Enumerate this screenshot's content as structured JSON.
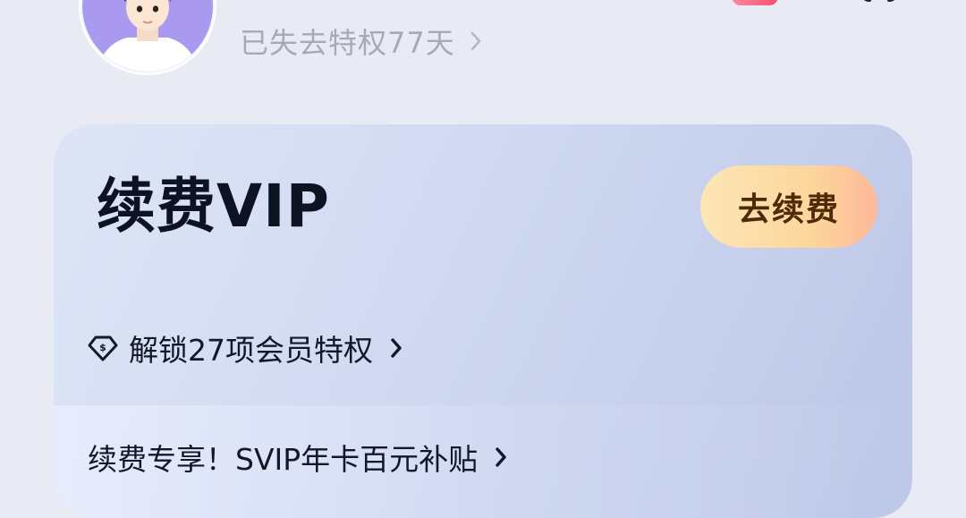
{
  "header": {
    "status_text": "已失去特权77天"
  },
  "vip_card": {
    "title": "续费VIP",
    "renew_button_label": "去续费",
    "privileges_text": "解锁27项会员特权",
    "promo_text": "续费专享！SVIP年卡百元补贴"
  },
  "colors": {
    "page_background": "#e8ebf4",
    "card_gradient_start": "#dde5f6",
    "card_gradient_end": "#bcc6e6",
    "button_gradient_start": "#fde6b6",
    "button_gradient_end": "#ffb89a",
    "button_text": "#4f2a08",
    "title_text": "#0d1322",
    "muted_text": "#a6a9b6"
  },
  "icons": {
    "status_chevron": "chevron-right-icon",
    "privileges_icon": "diamond-dollar-icon",
    "privileges_chevron": "chevron-right-icon",
    "promo_chevron": "chevron-right-icon"
  }
}
